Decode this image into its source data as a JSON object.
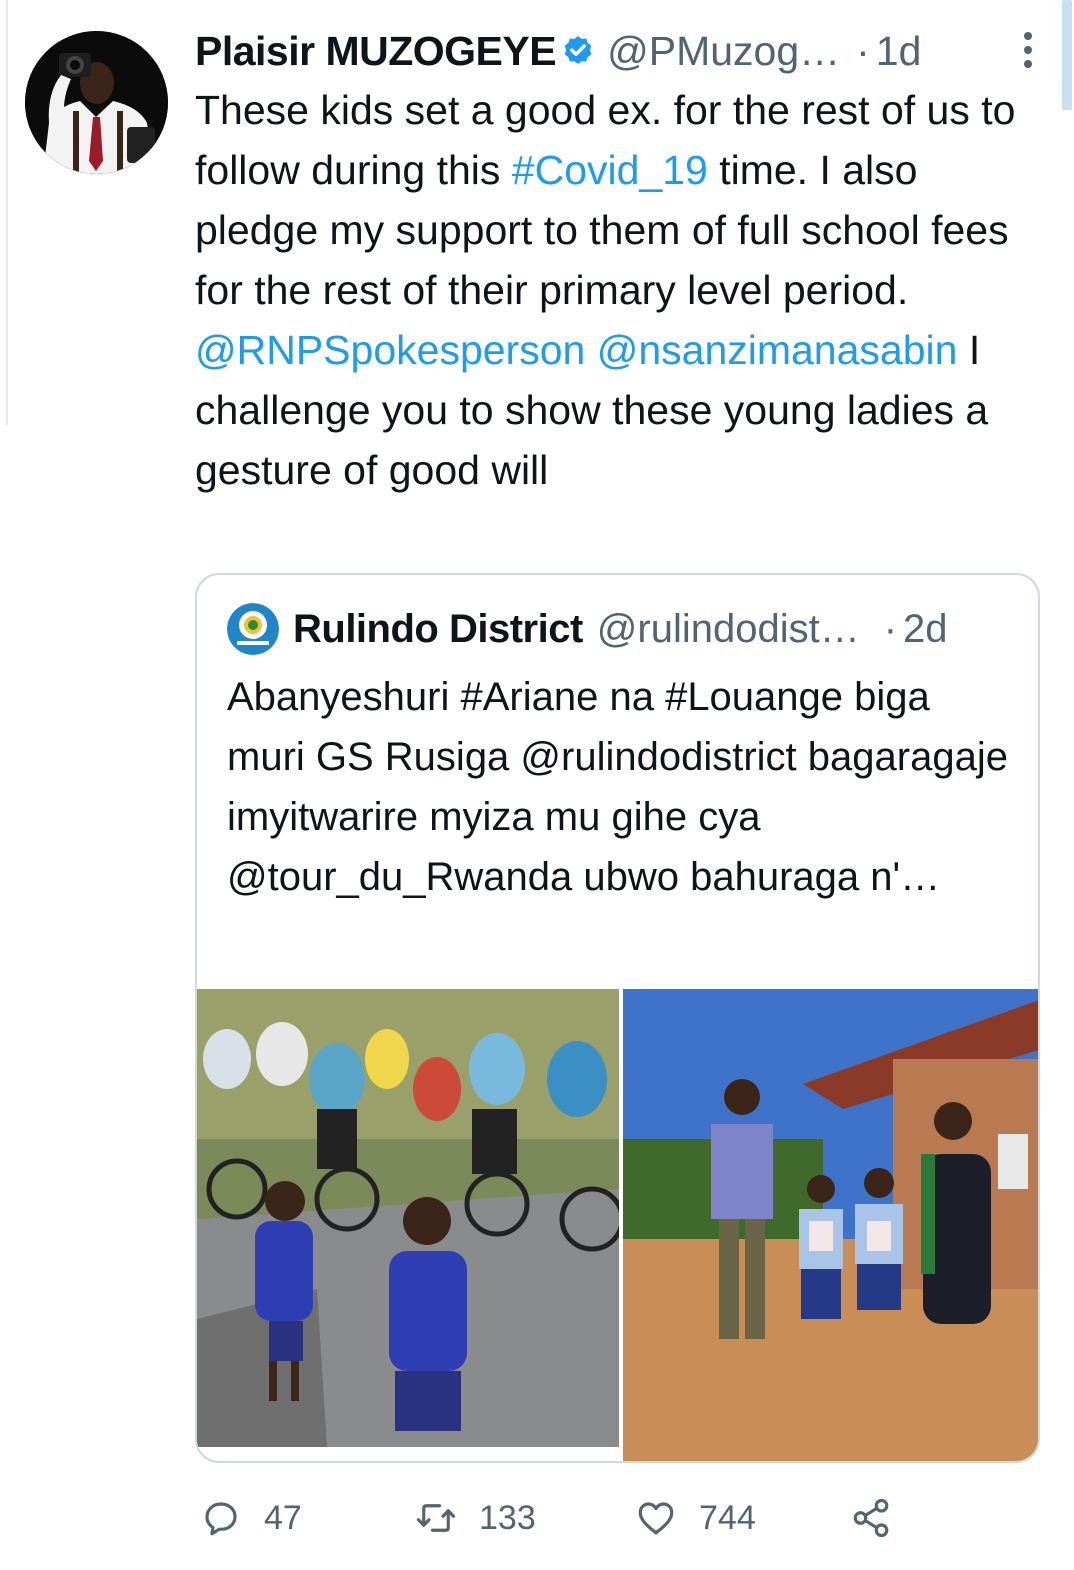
{
  "tweet": {
    "author_name": "Plaisir MUZOGEYE",
    "author_handle": "@PMuzog…",
    "separator": "·",
    "time": "1d",
    "text_parts": [
      "These kids set a good ex. for the rest of us to follow during this ",
      "#Covid_19",
      " time. I also pledge my support to them of full school fees for the rest of their primary level period. ",
      "@RNPSpokesperson",
      " ",
      "@nsanzimanasabin",
      " I challenge you to show these young ladies a gesture of good will"
    ]
  },
  "quoted_tweet": {
    "author_name": "Rulindo District",
    "author_handle": "@rulindodist…",
    "separator": "·",
    "time": "2d",
    "text": "Abanyeshuri #Ariane na #Louange biga muri GS Rusiga @rulindodistrict bagaragaje imyitwarire myiza mu gihe cya\n@tour_du_Rwanda ubwo bahuraga n'…"
  },
  "actions": {
    "reply_count": "47",
    "retweet_count": "133",
    "like_count": "744"
  },
  "colors": {
    "link": "#1d9bf0",
    "muted": "#536471",
    "verified": "#1d9bf0",
    "border": "#cfd9de"
  },
  "icons": [
    "verified-badge-icon",
    "more-options-icon",
    "reply-icon",
    "retweet-icon",
    "like-icon",
    "share-icon"
  ]
}
